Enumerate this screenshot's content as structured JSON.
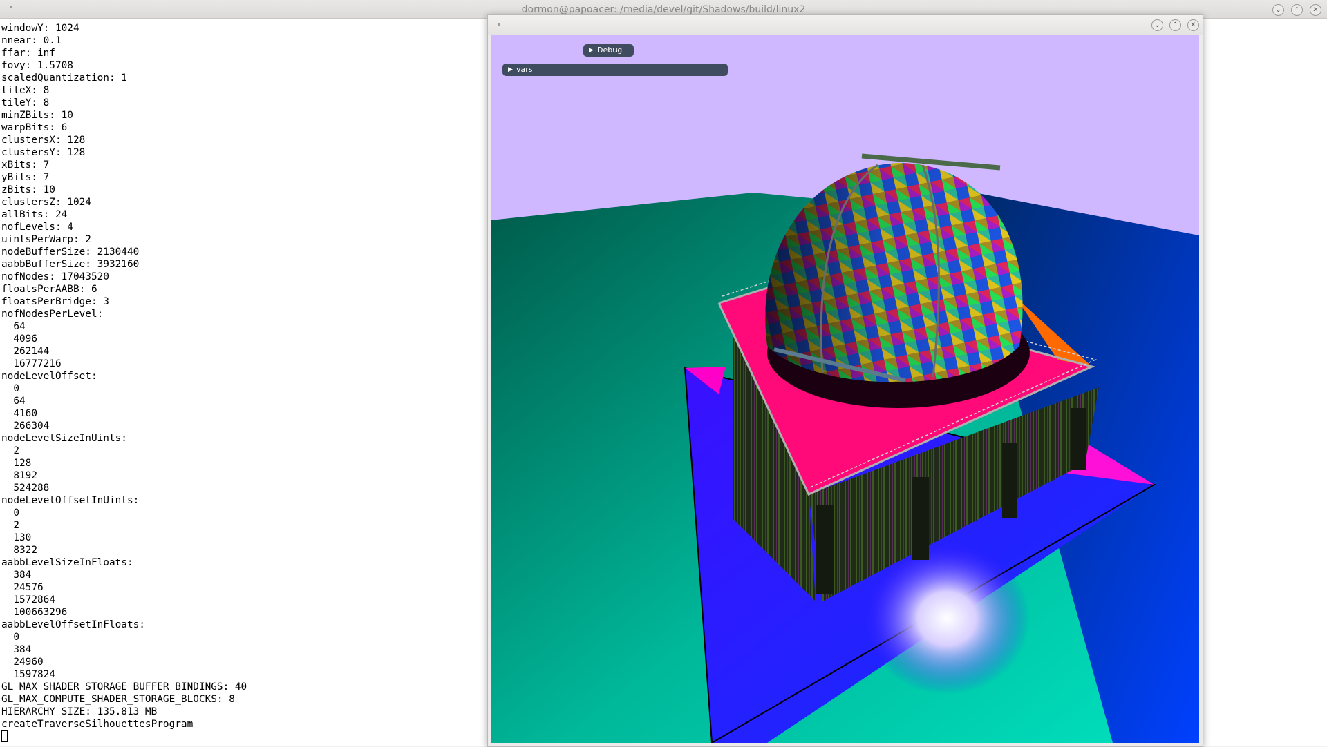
{
  "terminal": {
    "title": "dormon@papoacer: /media/devel/git/Shadows/build/linux2",
    "controls": {
      "minimize": "⌄",
      "maximize": "⌃",
      "close": "✕"
    },
    "lines": [
      "windowY: 1024",
      "nnear: 0.1",
      "ffar: inf",
      "fovy: 1.5708",
      "scaledQuantization: 1",
      "tileX: 8",
      "tileY: 8",
      "minZBits: 10",
      "warpBits: 6",
      "clustersX: 128",
      "clustersY: 128",
      "xBits: 7",
      "yBits: 7",
      "zBits: 10",
      "clustersZ: 1024",
      "allBits: 24",
      "nofLevels: 4",
      "uintsPerWarp: 2",
      "nodeBufferSize: 2130440",
      "aabbBufferSize: 3932160",
      "nofNodes: 17043520",
      "floatsPerAABB: 6",
      "floatsPerBridge: 3",
      "nofNodesPerLevel:",
      "  64",
      "  4096",
      "  262144",
      "  16777216",
      "nodeLevelOffset:",
      "  0",
      "  64",
      "  4160",
      "  266304",
      "nodeLevelSizeInUints:",
      "  2",
      "  128",
      "  8192",
      "  524288",
      "nodeLevelOffsetInUints:",
      "  0",
      "  2",
      "  130",
      "  8322",
      "aabbLevelSizeInFloats:",
      "  384",
      "  24576",
      "  1572864",
      "  100663296",
      "aabbLevelOffsetInFloats:",
      "  0",
      "  384",
      "  24960",
      "  1597824",
      "GL_MAX_SHADER_STORAGE_BUFFER_BINDINGS: 40",
      "GL_MAX_COMPUTE_SHADER_STORAGE_BLOCKS: 8",
      "HIERARCHY SIZE: 135.813 MB",
      "createTraverseSilhouettesProgram"
    ]
  },
  "app": {
    "controls": {
      "minimize": "⌄",
      "maximize": "⌃",
      "close": "✕"
    },
    "debug_window": {
      "label": "Debug",
      "arrow": "▶"
    },
    "vars_header": {
      "label": "vars",
      "arrow": "▶"
    },
    "colors": {
      "sky": "#cfb8ff",
      "ground": "#00c8a8",
      "plane": "#3a10ff",
      "imgui_header": "#3f4b5e"
    }
  }
}
